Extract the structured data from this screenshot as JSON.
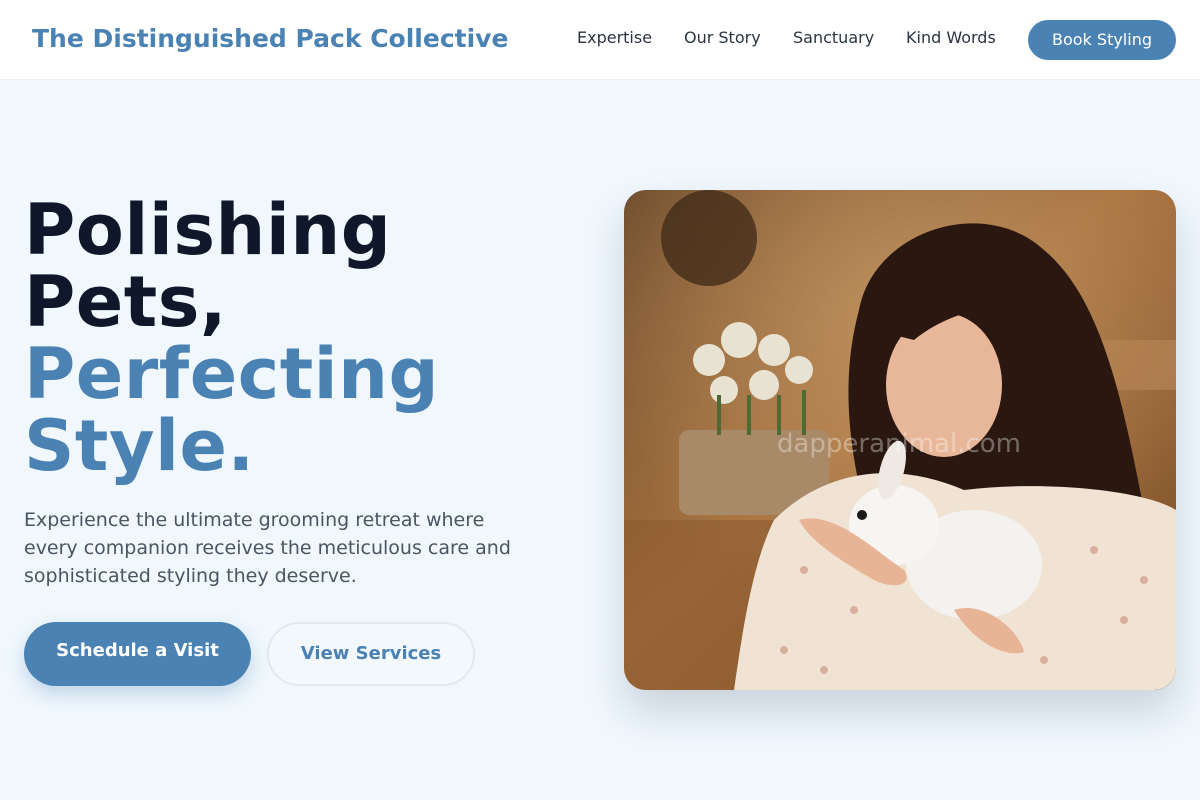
{
  "header": {
    "brand": "The Distinguished Pack Collective",
    "nav": [
      "Expertise",
      "Our Story",
      "Sanctuary",
      "Kind Words"
    ],
    "cta_label": "Book Styling"
  },
  "hero": {
    "title_line1": "Polishing",
    "title_line2": "Pets,",
    "title_line3": "Perfecting",
    "title_line4": "Style.",
    "description": "Experience the ultimate grooming retreat where every companion receives the meticulous care and sophisticated styling they deserve.",
    "primary_button": "Schedule a Visit",
    "secondary_button": "View Services"
  },
  "image": {
    "watermark": "dapperanimal.com",
    "alt": "Woman holding a white bunny"
  },
  "colors": {
    "accent": "#4a82b4",
    "background": "#f0f7fd",
    "heading": "#0f172a"
  }
}
